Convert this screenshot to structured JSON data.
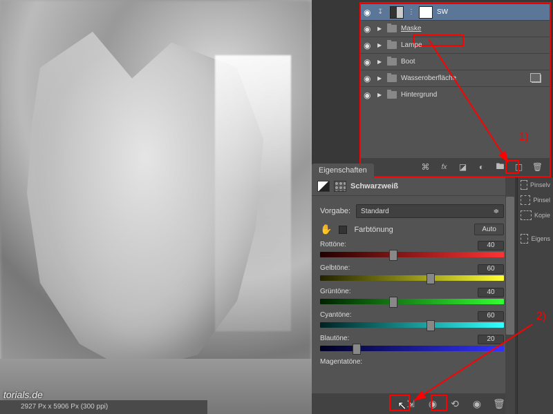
{
  "canvas": {
    "watermark": "torials.de",
    "status": "2927 Px x 5906 Px (300 ppi)"
  },
  "layers_footer_icons": {
    "link": "⬤",
    "fx": "fx",
    "mask": "◪",
    "adj": "◐",
    "group": "🖿",
    "new": "◫",
    "trash": "🗑"
  },
  "layers": [
    {
      "name": "SW",
      "selected": true,
      "type": "adj"
    },
    {
      "name": "Maske",
      "type": "folder",
      "highlight": true
    },
    {
      "name": "Lampe",
      "type": "folder"
    },
    {
      "name": "Boot",
      "type": "folder"
    },
    {
      "name": "Wasseroberfläche",
      "type": "folder"
    },
    {
      "name": "Hintergrund",
      "type": "folder"
    }
  ],
  "annotations": {
    "one": "1)",
    "two": "2)"
  },
  "properties": {
    "tab": "Eigenschaften",
    "title": "Schwarzweiß",
    "preset_label": "Vorgabe:",
    "preset_value": "Standard",
    "tint_label": "Farbtönung",
    "auto": "Auto",
    "sliders": {
      "red": {
        "label": "Rottöne:",
        "value": "40"
      },
      "yellow": {
        "label": "Gelbtöne:",
        "value": "60"
      },
      "green": {
        "label": "Grüntöne:",
        "value": "40"
      },
      "cyan": {
        "label": "Cyantöne:",
        "value": "60"
      },
      "blue": {
        "label": "Blautöne:",
        "value": "20"
      },
      "magenta": {
        "label": "Magentatöne:"
      }
    }
  },
  "side": {
    "brushpresets": "Pinselv",
    "brush": "Pinsel",
    "clone": "Kopie",
    "propshort": "Eigens"
  }
}
